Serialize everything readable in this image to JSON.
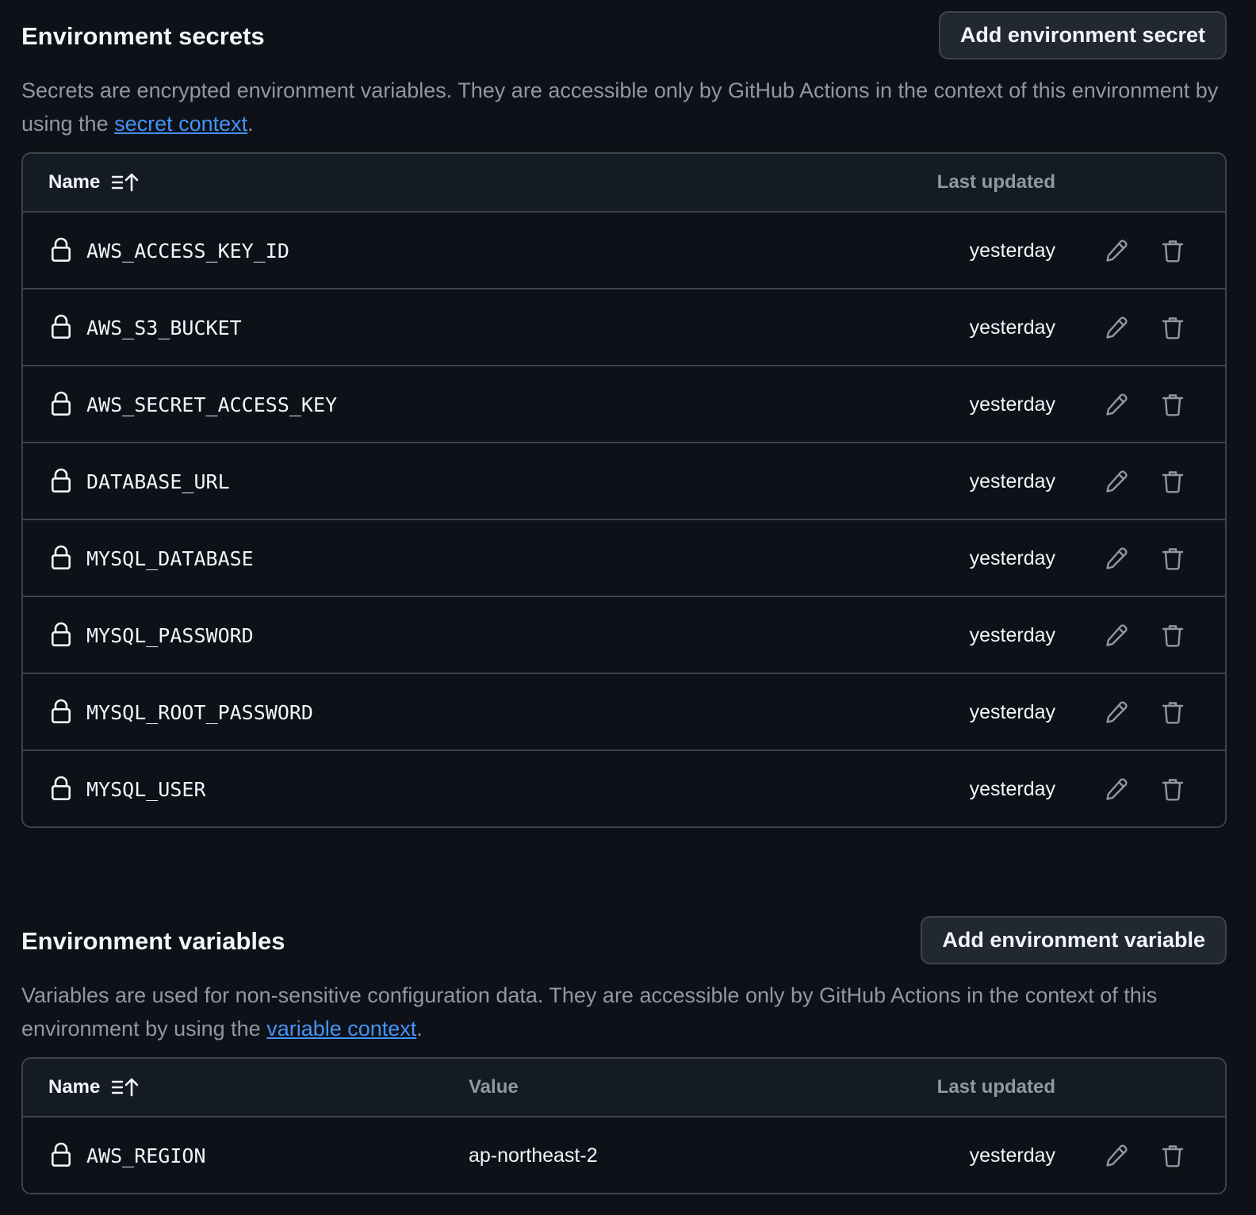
{
  "secrets": {
    "title": "Environment secrets",
    "add_button": "Add environment secret",
    "description_prefix": "Secrets are encrypted environment variables. They are accessible only by GitHub Actions in the context of this environment by using the ",
    "description_link": "secret context",
    "description_suffix": ".",
    "columns": {
      "name": "Name",
      "updated": "Last updated"
    },
    "rows": [
      {
        "name": "AWS_ACCESS_KEY_ID",
        "updated": "yesterday"
      },
      {
        "name": "AWS_S3_BUCKET",
        "updated": "yesterday"
      },
      {
        "name": "AWS_SECRET_ACCESS_KEY",
        "updated": "yesterday"
      },
      {
        "name": "DATABASE_URL",
        "updated": "yesterday"
      },
      {
        "name": "MYSQL_DATABASE",
        "updated": "yesterday"
      },
      {
        "name": "MYSQL_PASSWORD",
        "updated": "yesterday"
      },
      {
        "name": "MYSQL_ROOT_PASSWORD",
        "updated": "yesterday"
      },
      {
        "name": "MYSQL_USER",
        "updated": "yesterday"
      }
    ]
  },
  "variables": {
    "title": "Environment variables",
    "add_button": "Add environment variable",
    "description_prefix": "Variables are used for non-sensitive configuration data. They are accessible only by GitHub Actions in the context of this environment by using the ",
    "description_link": "variable context",
    "description_suffix": ".",
    "columns": {
      "name": "Name",
      "value": "Value",
      "updated": "Last updated"
    },
    "rows": [
      {
        "name": "AWS_REGION",
        "value": "ap-northeast-2",
        "updated": "yesterday"
      }
    ]
  },
  "icons": {
    "sort": "sort-ascending-icon",
    "lock": "lock-icon",
    "edit": "pencil-icon",
    "delete": "trash-icon"
  },
  "colors": {
    "background": "#0e1117",
    "header_bg": "#151b23",
    "border": "#3d444d",
    "text": "#f0f6fc",
    "muted": "#9198a1",
    "link": "#4493f8"
  }
}
